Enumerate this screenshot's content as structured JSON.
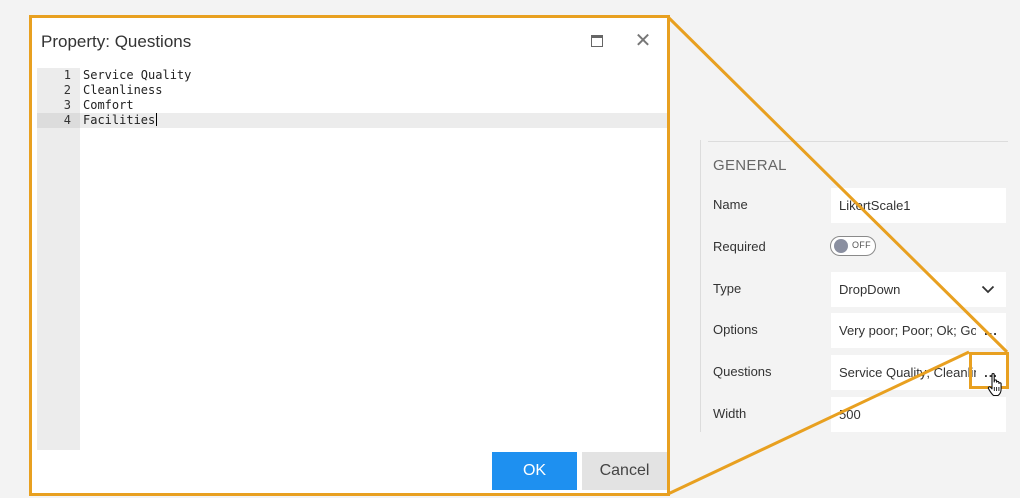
{
  "dialog": {
    "title": "Property: Questions",
    "ok_label": "OK",
    "cancel_label": "Cancel",
    "lines": [
      {
        "num": "1",
        "text": "Service Quality"
      },
      {
        "num": "2",
        "text": "Cleanliness"
      },
      {
        "num": "3",
        "text": "Comfort"
      },
      {
        "num": "4",
        "text": "Facilities"
      }
    ],
    "icons": {
      "maximize": "maximize-icon",
      "close": "close-icon"
    }
  },
  "panel": {
    "section_title": "GENERAL",
    "name": {
      "label": "Name",
      "value": "LikertScale1"
    },
    "required": {
      "label": "Required",
      "toggle_text": "OFF"
    },
    "type": {
      "label": "Type",
      "value": "DropDown"
    },
    "options": {
      "label": "Options",
      "value": "Very poor; Poor; Ok; Good; Very good",
      "button": "..."
    },
    "questions": {
      "label": "Questions",
      "value": "Service Quality; Cleanliness; Comfort; Facilities",
      "button": "..."
    },
    "width": {
      "label": "Width",
      "value": "500"
    }
  },
  "colors": {
    "highlight": "#e8a020",
    "primary": "#1e90f0",
    "background": "#f3f3f3"
  }
}
